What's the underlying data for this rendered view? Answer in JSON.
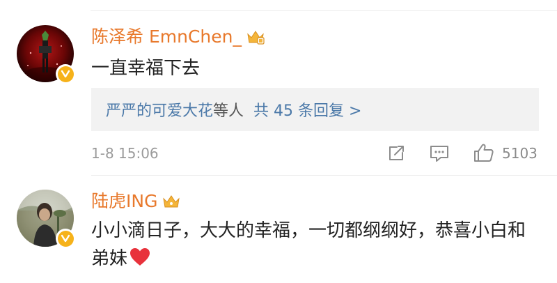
{
  "comments": [
    {
      "username": "陈泽希 EmnChen_",
      "text": "一直幸福下去",
      "reply_summary": {
        "who": "严严的可爱大花",
        "suffix": "等人",
        "count_label": "共 45 条回复 >"
      },
      "timestamp": "1-8 15:06",
      "like_count": "5103"
    },
    {
      "username": "陆虎ING",
      "text": "小小滴日子，大大的幸福，一切都纲纲好，恭喜小白和弟妹"
    }
  ],
  "colors": {
    "username": "#e8792c",
    "link": "#4a78a8",
    "text": "#222222",
    "meta": "#9a9a9a",
    "verified_badge": "#f6b21a",
    "reply_box_bg": "#f2f2f2",
    "heart": "#e8323c"
  },
  "icons": [
    "verified-icon",
    "crown-icon",
    "forward-icon",
    "comment-icon",
    "like-icon",
    "heart-emoji"
  ]
}
